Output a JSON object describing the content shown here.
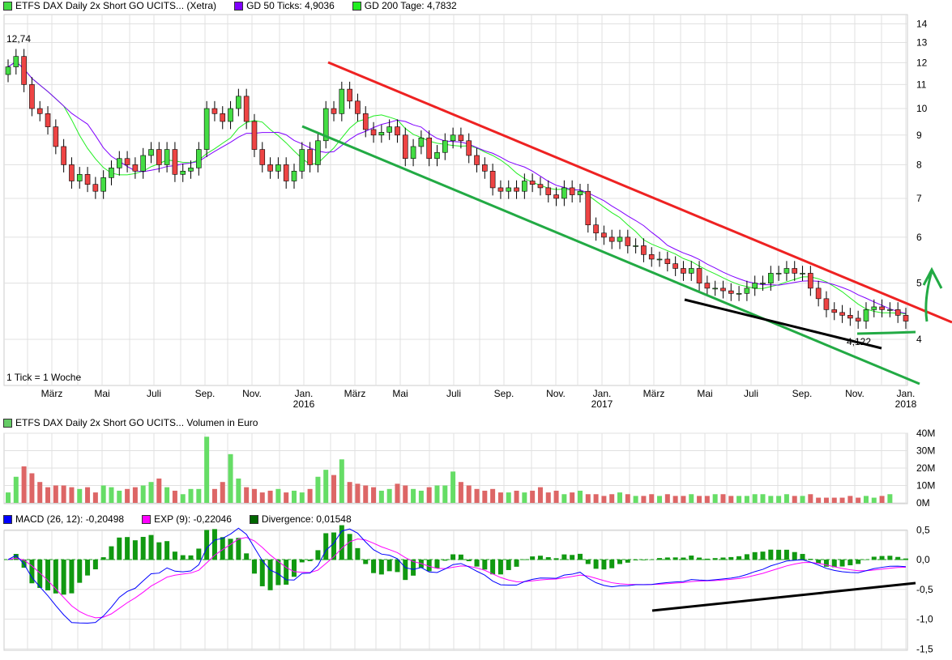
{
  "legend_price": [
    {
      "label": "ETFS DAX Daily 2x Short GO UCITS... (Xetra)",
      "color": "#44dd44"
    },
    {
      "label": "GD 50 Ticks: 4,9036",
      "color": "#8000ff"
    },
    {
      "label": "GD 200 Tage: 4,7832",
      "color": "#22ee22"
    }
  ],
  "legend_volume": {
    "label": "ETFS DAX Daily 2x Short GO UCITS... Volumen in Euro",
    "color": "#66cc66"
  },
  "legend_macd": [
    {
      "label": "MACD (26, 12): -0,20498",
      "color": "#0000ff"
    },
    {
      "label": "EXP (9): -0,22046",
      "color": "#ff00ff"
    },
    {
      "label": "Divergence: 0,01548",
      "color": "#006600"
    }
  ],
  "annotations": {
    "high": "12,74",
    "low": "4,122",
    "tick_note": "1 Tick = 1 Woche"
  },
  "chart_data": [
    {
      "type": "candlestick",
      "title": "ETFS DAX Daily 2x Short GO UCITS... (Xetra)",
      "yscale": "log",
      "ylim": [
        3.5,
        14.5
      ],
      "yticks": [
        "14",
        "13",
        "12",
        "11",
        "10",
        "9",
        "8",
        "7",
        "6",
        "5",
        "4"
      ],
      "xticks": [
        {
          "m": "März"
        },
        {
          "m": "Mai"
        },
        {
          "m": "Juli"
        },
        {
          "m": "Sep."
        },
        {
          "m": "Nov."
        },
        {
          "m": "Jan.",
          "y": "2016"
        },
        {
          "m": "März"
        },
        {
          "m": "Mai"
        },
        {
          "m": "Juli"
        },
        {
          "m": "Sep."
        },
        {
          "m": "Nov."
        },
        {
          "m": "Jan.",
          "y": "2017"
        },
        {
          "m": "März"
        },
        {
          "m": "Mai"
        },
        {
          "m": "Juli"
        },
        {
          "m": "Sep."
        },
        {
          "m": "Nov."
        },
        {
          "m": "Jan.",
          "y": "2018"
        }
      ],
      "close": [
        11.8,
        12.3,
        11.0,
        10.0,
        9.8,
        9.3,
        8.6,
        8.0,
        7.5,
        7.7,
        7.4,
        7.2,
        7.6,
        7.9,
        8.2,
        8.0,
        7.8,
        8.3,
        8.5,
        8.0,
        8.5,
        7.7,
        7.8,
        7.9,
        8.5,
        10.0,
        9.8,
        9.5,
        10.0,
        10.5,
        9.5,
        8.5,
        8.0,
        7.8,
        8.0,
        7.5,
        7.8,
        8.5,
        8.0,
        8.8,
        10.0,
        9.8,
        10.8,
        10.3,
        9.8,
        9.2,
        9.0,
        9.1,
        9.3,
        9.0,
        8.2,
        8.6,
        8.9,
        8.2,
        8.4,
        8.8,
        9.0,
        8.8,
        8.3,
        8.0,
        7.8,
        7.3,
        7.2,
        7.3,
        7.2,
        7.5,
        7.4,
        7.3,
        7.1,
        7.0,
        7.3,
        7.1,
        7.2,
        6.3,
        6.1,
        6.0,
        5.9,
        6.0,
        5.8,
        5.8,
        5.6,
        5.5,
        5.5,
        5.4,
        5.3,
        5.2,
        5.3,
        5.0,
        4.9,
        4.9,
        4.85,
        4.8,
        4.8,
        4.9,
        5.0,
        5.0,
        5.2,
        5.2,
        5.3,
        5.2,
        5.2,
        4.9,
        4.7,
        4.5,
        4.45,
        4.4,
        4.35,
        4.3,
        4.5,
        4.55,
        4.5,
        4.5,
        4.4,
        4.3
      ]
    },
    {
      "type": "bar",
      "title": "Volumen in Euro",
      "yticks": [
        "40M",
        "30M",
        "20M",
        "10M",
        "0M"
      ],
      "ylim": [
        0,
        40
      ],
      "values": [
        6,
        15,
        21,
        17,
        12,
        9,
        10,
        10,
        9,
        8,
        9,
        6,
        10,
        9,
        7,
        8,
        9,
        10,
        12,
        14,
        9,
        7,
        5,
        8,
        8,
        38,
        8,
        12,
        28,
        14,
        9,
        8,
        6,
        7,
        8,
        6,
        7,
        6,
        8,
        15,
        19,
        16,
        25,
        12,
        11,
        10,
        9,
        7,
        8,
        11,
        10,
        8,
        7,
        9,
        10,
        10,
        18,
        12,
        10,
        8,
        7,
        8,
        6,
        6,
        7,
        6,
        7,
        9,
        6,
        7,
        5,
        6,
        7,
        5,
        5,
        4,
        5,
        6,
        5,
        4,
        4,
        5,
        4,
        5,
        4,
        4,
        5,
        4,
        4,
        5,
        5,
        4,
        4,
        4,
        5,
        5,
        4,
        4,
        5,
        4,
        4,
        5,
        3,
        3,
        3,
        3,
        4,
        3,
        4,
        3,
        4,
        5
      ]
    },
    {
      "type": "line",
      "title": "MACD",
      "yticks": [
        "0,5",
        "0,0",
        "-0,5",
        "-1,0",
        "-1,5"
      ],
      "ylim": [
        -1.5,
        0.5
      ]
    }
  ]
}
